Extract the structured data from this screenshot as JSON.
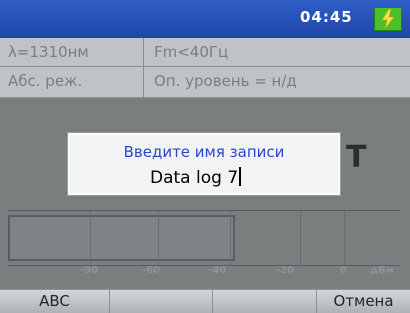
{
  "status_bar": {
    "time": "04:45",
    "battery_icon": "charging-battery-icon",
    "battery_color": "#49c12c"
  },
  "info_panel": {
    "wavelength": "λ=1310нм",
    "modulation": "Fm<40Гц",
    "mode": "Абс. реж.",
    "reference_level": "Оп. уровень = н/д"
  },
  "measurement": {
    "value": "− − −",
    "unit": "Т"
  },
  "bar_graph": {
    "fill_fraction": 0.58,
    "scale_labels": [
      "-90",
      "-60",
      "-40",
      "-20",
      "0",
      "дБм"
    ]
  },
  "dialog": {
    "title": "Введите имя записи",
    "input_value": "Data log 7"
  },
  "softkeys": [
    {
      "label": "ABC"
    },
    {
      "label": ""
    },
    {
      "label": ""
    },
    {
      "label": "Отмена"
    }
  ],
  "colors": {
    "header_blue": "#2f5ec5",
    "dialog_title_blue": "#2a46c8"
  }
}
